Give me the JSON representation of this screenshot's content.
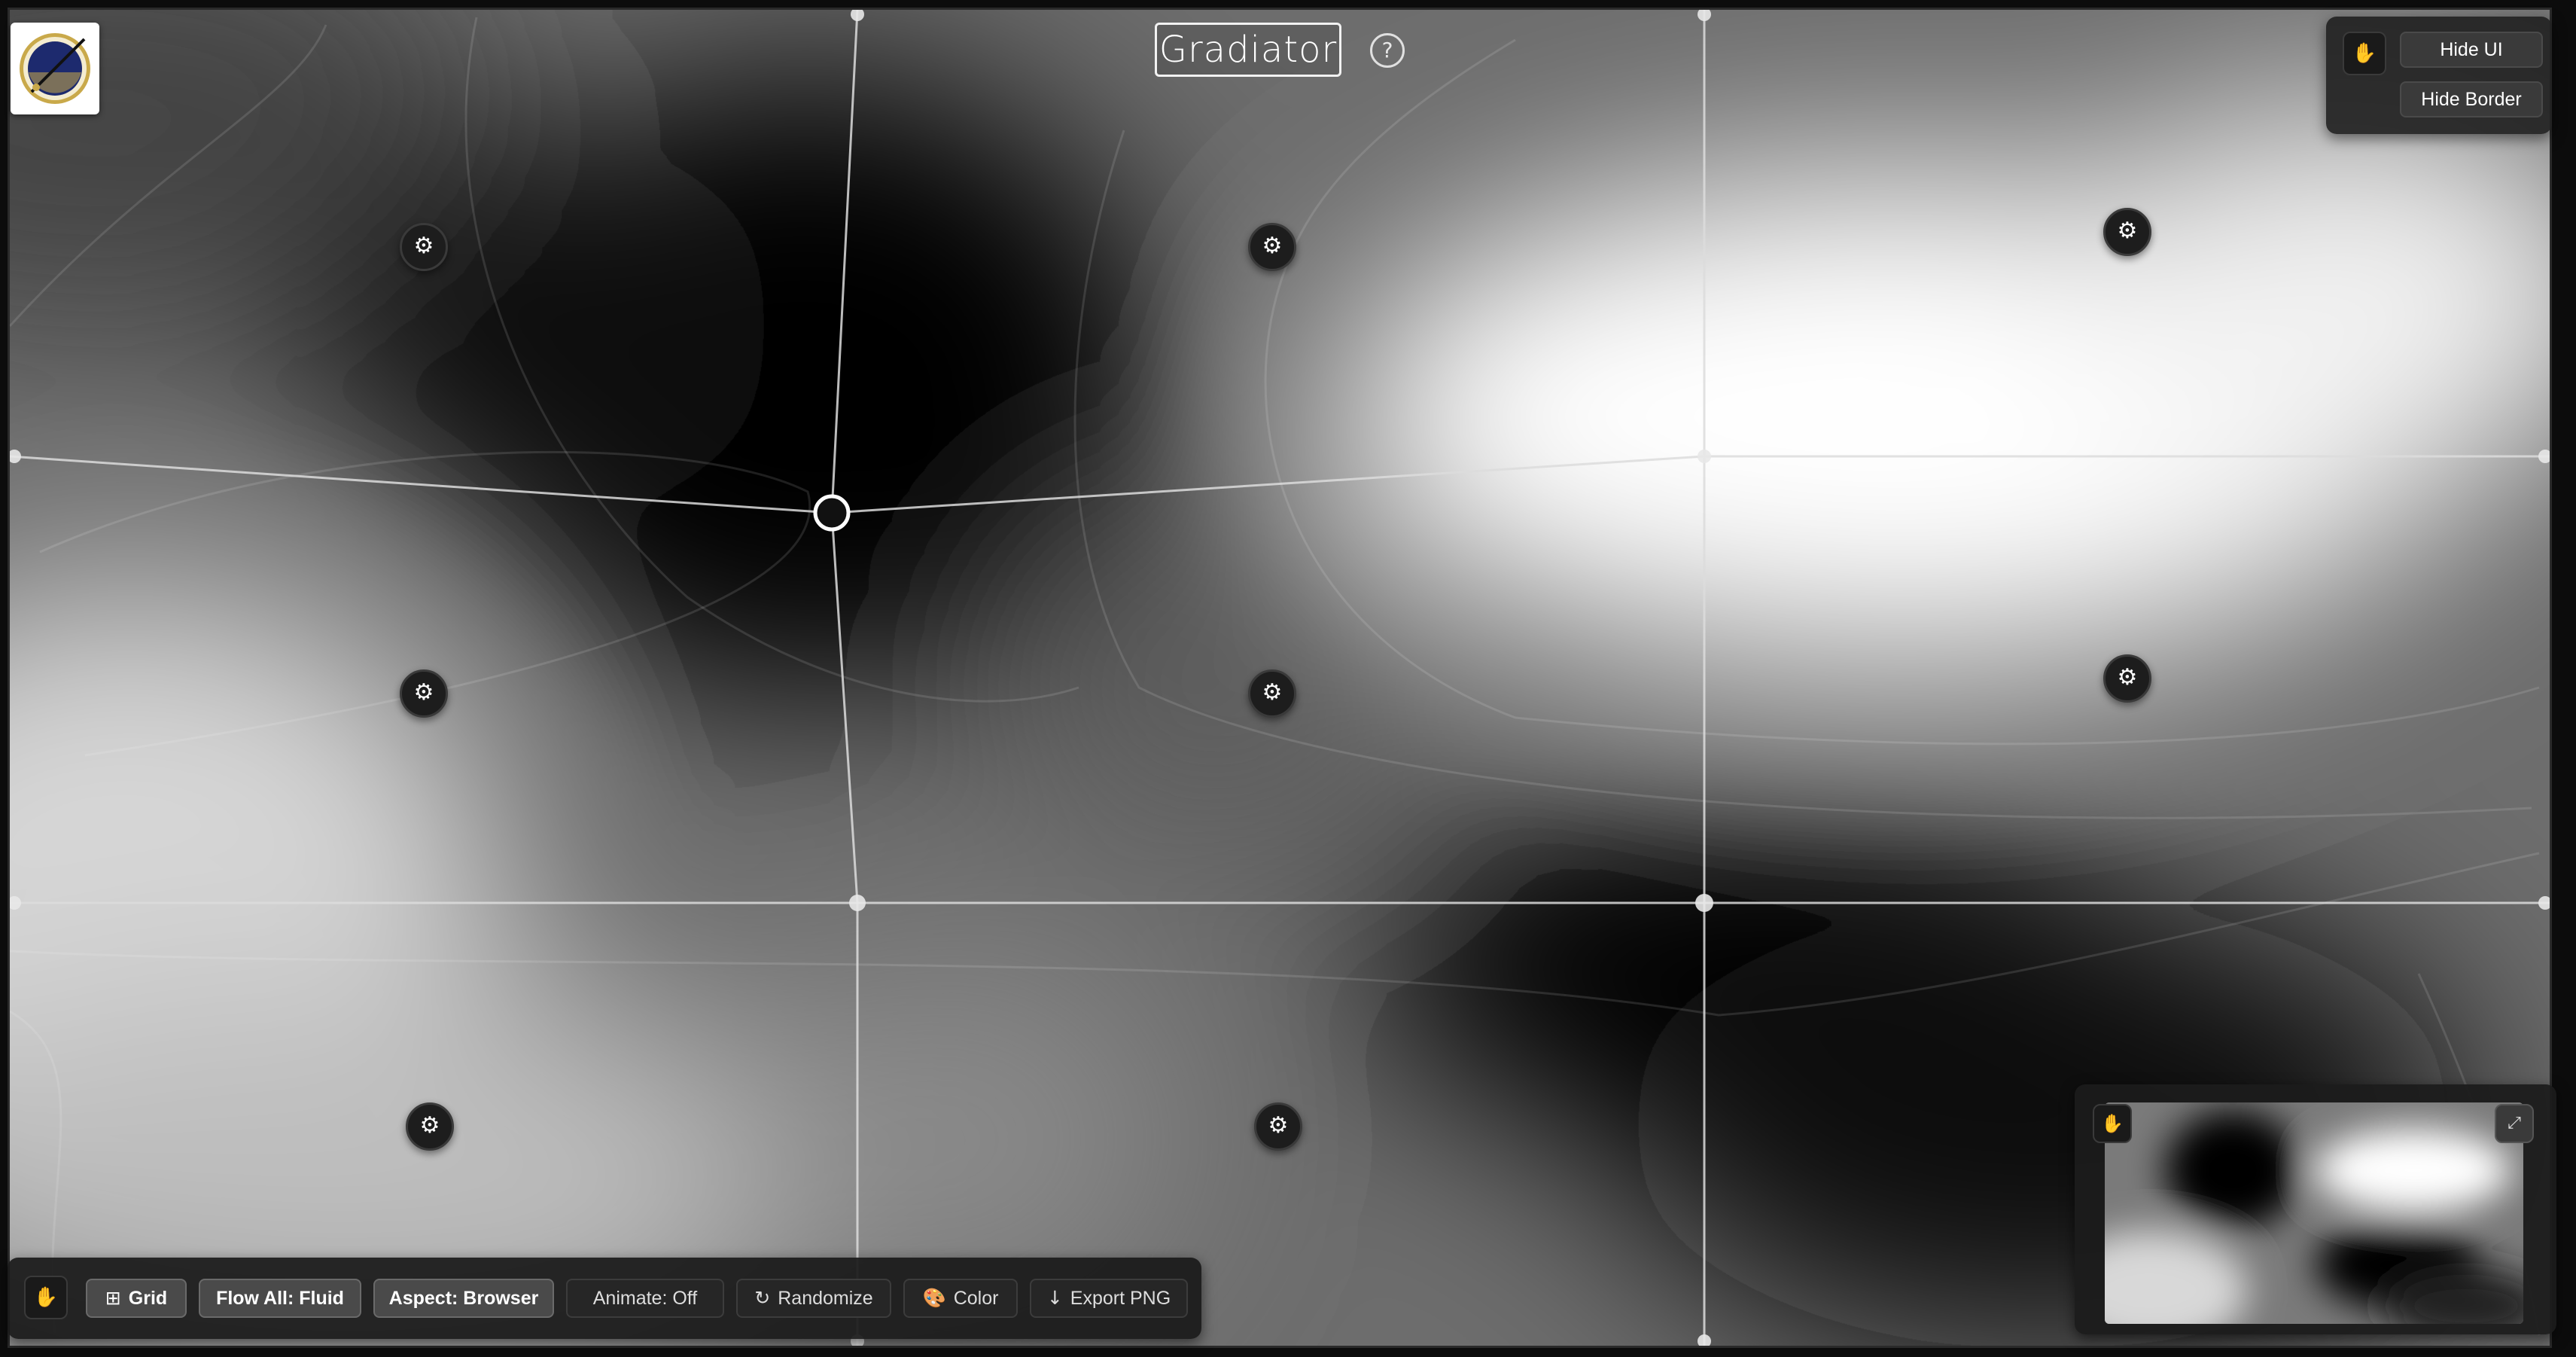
{
  "app": {
    "title": "Gradiator",
    "help_glyph": "?"
  },
  "logo": {
    "name": "gradiator-logo",
    "colors": {
      "disc": "#1d2a6e",
      "ring": "#c9a94a",
      "needle": "#111111"
    }
  },
  "top_panel": {
    "hand_glyph": "✋",
    "hide_ui_label": "Hide UI",
    "hide_border_label": "Hide Border"
  },
  "canvas": {
    "grid": {
      "columns": 3,
      "rows": 3
    },
    "colors": {
      "dark": "#000000",
      "light": "#ffffff",
      "line": "#dcdcdc"
    },
    "tiles": [
      {
        "row": 1,
        "col": 1,
        "gear_glyph": "⚙"
      },
      {
        "row": 1,
        "col": 2,
        "gear_glyph": "⚙"
      },
      {
        "row": 1,
        "col": 3,
        "gear_glyph": "⚙"
      },
      {
        "row": 2,
        "col": 1,
        "gear_glyph": "⚙"
      },
      {
        "row": 2,
        "col": 2,
        "gear_glyph": "⚙"
      },
      {
        "row": 2,
        "col": 3,
        "gear_glyph": "⚙"
      },
      {
        "row": 3,
        "col": 1,
        "gear_glyph": "⚙"
      },
      {
        "row": 3,
        "col": 2,
        "gear_glyph": "⚙"
      }
    ]
  },
  "toolbar": {
    "hand_glyph": "✋",
    "buttons": [
      {
        "id": "grid",
        "glyph": "⊞",
        "label": "Grid",
        "active": true
      },
      {
        "id": "flow",
        "glyph": "",
        "label": "Flow All: Fluid",
        "active": true
      },
      {
        "id": "aspect",
        "glyph": "",
        "label": "Aspect: Browser",
        "active": true
      },
      {
        "id": "animate",
        "glyph": "",
        "label": "Animate: Off",
        "active": false
      },
      {
        "id": "randomize",
        "glyph": "↻",
        "label": "Randomize",
        "active": false
      },
      {
        "id": "color",
        "glyph": "🎨",
        "label": "Color",
        "active": false
      },
      {
        "id": "export",
        "glyph": "↓",
        "label": "Export PNG",
        "active": false
      }
    ]
  },
  "minimap": {
    "hand_glyph": "✋",
    "expand_glyph": "⤢"
  }
}
